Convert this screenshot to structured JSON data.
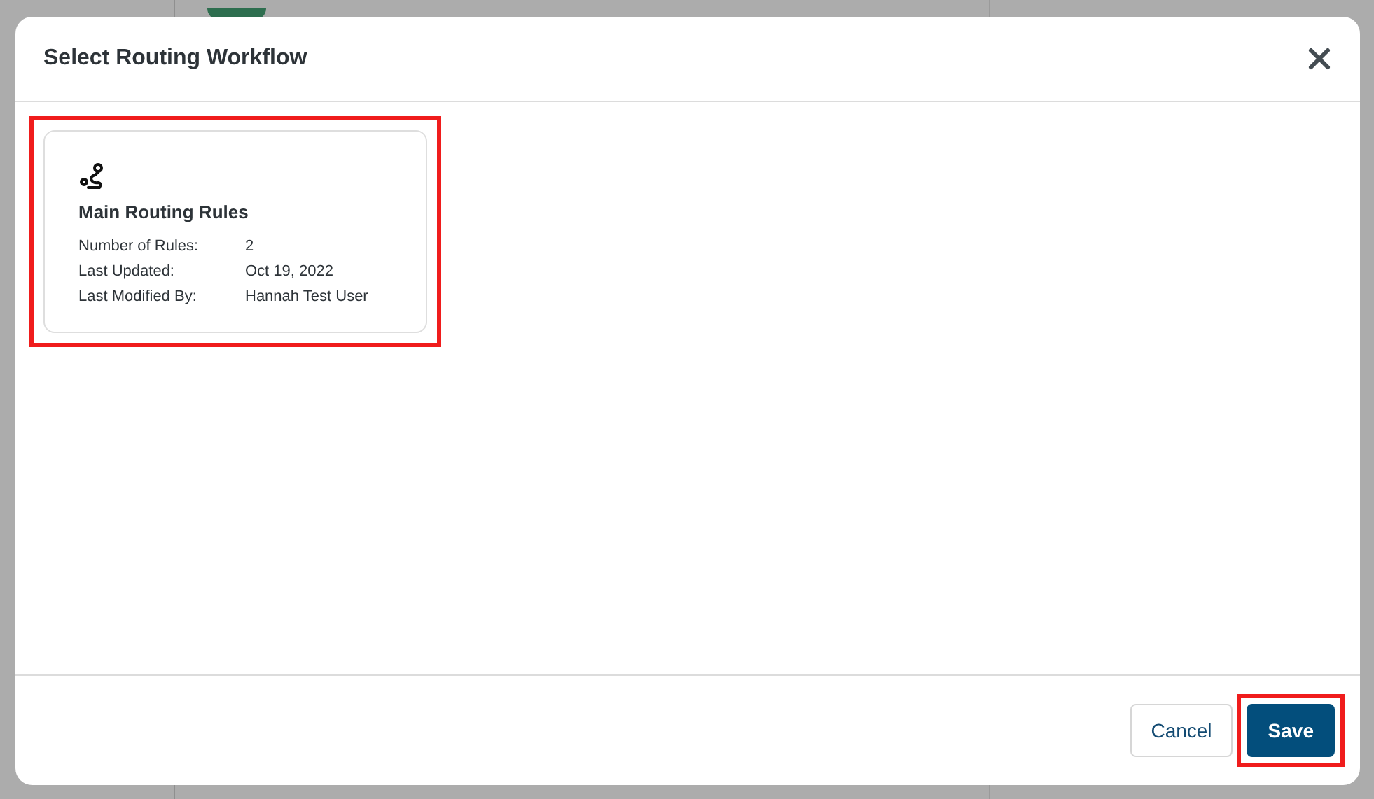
{
  "dialog": {
    "title": "Select Routing Workflow",
    "workflows": [
      {
        "name": "Main Routing Rules",
        "details": [
          {
            "label": "Number of Rules:",
            "value": "2"
          },
          {
            "label": "Last Updated:",
            "value": "Oct 19, 2022"
          },
          {
            "label": "Last Modified By:",
            "value": "Hannah Test User"
          }
        ]
      }
    ],
    "buttons": [
      {
        "label": "Cancel",
        "kind": "secondary"
      },
      {
        "label": "Save",
        "kind": "primary"
      }
    ]
  }
}
